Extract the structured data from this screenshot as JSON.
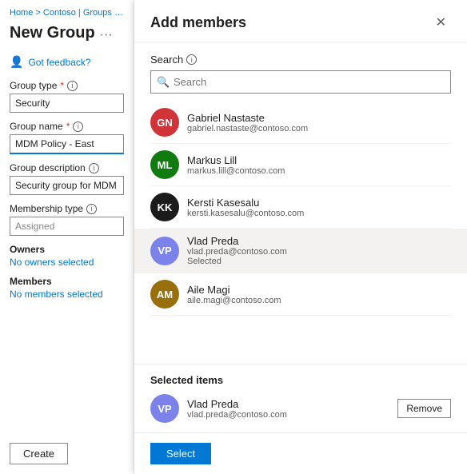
{
  "breadcrumb": {
    "text": "Home > Contoso | Groups > Gr"
  },
  "left_panel": {
    "page_title": "New Group",
    "feedback_label": "Got feedback?",
    "form": {
      "group_type": {
        "label": "Group type",
        "required": "*",
        "value": "Security"
      },
      "group_name": {
        "label": "Group name",
        "required": "*",
        "value": "MDM Policy - East"
      },
      "group_description": {
        "label": "Group description",
        "value": "Security group for MDM East"
      },
      "membership_type": {
        "label": "Membership type",
        "value": "Assigned"
      },
      "owners": {
        "label": "Owners",
        "link": "No owners selected"
      },
      "members": {
        "label": "Members",
        "link": "No members selected"
      }
    },
    "create_button": "Create"
  },
  "modal": {
    "title": "Add members",
    "close_label": "✕",
    "search": {
      "label": "Search",
      "placeholder": "Search"
    },
    "users": [
      {
        "initials": "GN",
        "name": "Gabriel Nastaste",
        "email": "gabriel.nastaste@contoso.com",
        "color": "#d13438",
        "selected": false
      },
      {
        "initials": "ML",
        "name": "Markus Lill",
        "email": "markus.lill@contoso.com",
        "color": "#107c10",
        "selected": false
      },
      {
        "initials": "KK",
        "name": "Kersti Kasesalu",
        "email": "kersti.kasesalu@contoso.com",
        "color": "#1b1b1b",
        "selected": false
      },
      {
        "initials": "VP",
        "name": "Vlad Preda",
        "email": "vlad.preda@contoso.com",
        "color": "#7b83eb",
        "selected": true,
        "selected_label": "Selected"
      },
      {
        "initials": "AM",
        "name": "Aile Magi",
        "email": "aile.magi@contoso.com",
        "color": "#986f0b",
        "selected": false
      }
    ],
    "selected_items": {
      "title": "Selected items",
      "user": {
        "initials": "VP",
        "name": "Vlad Preda",
        "email": "vlad.preda@contoso.com",
        "color": "#7b83eb"
      },
      "remove_label": "Remove"
    },
    "select_button": "Select"
  }
}
